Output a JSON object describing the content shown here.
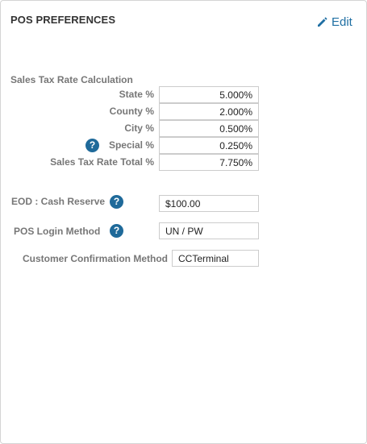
{
  "panel": {
    "title": "POS PREFERENCES",
    "edit_label": "Edit",
    "accent_color": "#1f6fa3"
  },
  "sales_tax": {
    "title": "Sales Tax Rate Calculation",
    "rows": [
      {
        "label": "State %",
        "value": "5.000%",
        "help": false
      },
      {
        "label": "County %",
        "value": "2.000%",
        "help": false
      },
      {
        "label": "City %",
        "value": "0.500%",
        "help": false
      },
      {
        "label": "Special %",
        "value": "0.250%",
        "help": true
      },
      {
        "label": "Sales Tax Rate Total %",
        "value": "7.750%",
        "help": false
      }
    ]
  },
  "eod": {
    "label": "EOD : Cash Reserve",
    "value": "$100.00",
    "help": true
  },
  "pos_login": {
    "label": "POS Login Method",
    "value": "UN / PW",
    "help": true
  },
  "customer_confirmation": {
    "label": "Customer Confirmation Method",
    "value": "CCTerminal"
  },
  "icons": {
    "edit": "pencil-icon",
    "help": "question-circle-icon"
  }
}
